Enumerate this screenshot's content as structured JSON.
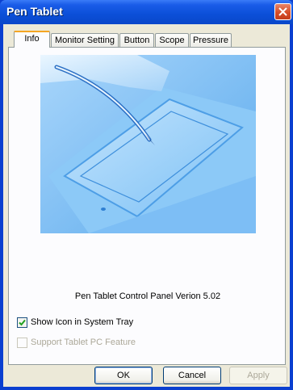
{
  "window": {
    "title": "Pen Tablet"
  },
  "tabs": [
    {
      "label": "Info",
      "active": true
    },
    {
      "label": "Monitor Setting",
      "active": false
    },
    {
      "label": "Button",
      "active": false
    },
    {
      "label": "Scope",
      "active": false
    },
    {
      "label": "Pressure",
      "active": false
    }
  ],
  "info": {
    "version_text": "Pen Tablet Control Panel Verion 5.02",
    "show_icon": {
      "label": "Show Icon in System Tray",
      "checked": true,
      "enabled": true
    },
    "support_tablet_pc": {
      "label": "Support Tablet PC Feature",
      "checked": false,
      "enabled": false
    }
  },
  "buttons": {
    "ok": "OK",
    "cancel": "Cancel",
    "apply": "Apply"
  },
  "colors": {
    "title_bar": "#0a4fd8",
    "dialog_bg": "#ece9d8",
    "close_red": "#d64d28",
    "illustration_blue": "#6fb4f0"
  }
}
